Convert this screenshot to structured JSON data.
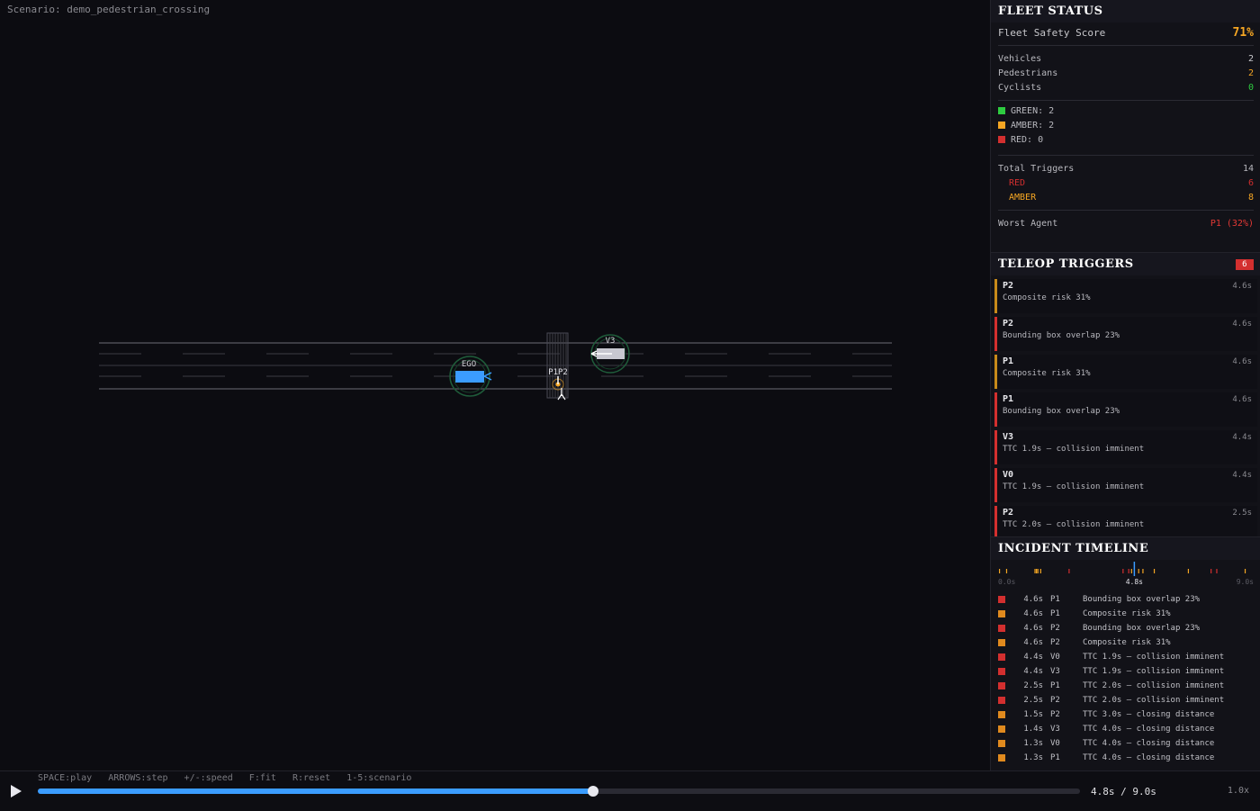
{
  "scene": {
    "scenario_label": "Scenario: demo_pedestrian_crossing",
    "ego_label": "EGO",
    "v3_label": "V3",
    "crossing_labels": "P1P2"
  },
  "fleet": {
    "title": "FLEET STATUS",
    "score_label": "Fleet Safety Score",
    "score_value": "71%",
    "vehicles_label": "Vehicles",
    "vehicles_value": "2",
    "pedestrians_label": "Pedestrians",
    "pedestrians_value": "2",
    "cyclists_label": "Cyclists",
    "cyclists_value": "0",
    "green_label": "GREEN: 2",
    "amber_label": "AMBER: 2",
    "red_label": "RED: 0",
    "total_triggers_label": "Total Triggers",
    "total_triggers_value": "14",
    "red_triggers_label": "RED",
    "red_triggers_value": "6",
    "amber_triggers_label": "AMBER",
    "amber_triggers_value": "8",
    "worst_agent_label": "Worst Agent",
    "worst_agent_value": "P1 (32%)"
  },
  "teleop": {
    "title": "TELEOP TRIGGERS",
    "badge": "6",
    "items": [
      {
        "agent": "P2",
        "time": "4.6s",
        "msg": "Composite risk 31%",
        "level": "amber"
      },
      {
        "agent": "P2",
        "time": "4.6s",
        "msg": "Bounding box overlap 23%",
        "level": "red"
      },
      {
        "agent": "P1",
        "time": "4.6s",
        "msg": "Composite risk 31%",
        "level": "amber"
      },
      {
        "agent": "P1",
        "time": "4.6s",
        "msg": "Bounding box overlap 23%",
        "level": "red"
      },
      {
        "agent": "V3",
        "time": "4.4s",
        "msg": "TTC 1.9s — collision imminent",
        "level": "red"
      },
      {
        "agent": "V0",
        "time": "4.4s",
        "msg": "TTC 1.9s — collision imminent",
        "level": "red"
      },
      {
        "agent": "P2",
        "time": "2.5s",
        "msg": "TTC 2.0s — collision imminent",
        "level": "red"
      }
    ]
  },
  "timeline": {
    "title": "INCIDENT TIMELINE",
    "start_label": "0.0s",
    "current_label": "4.8s",
    "end_label": "9.0s",
    "rows": [
      {
        "level": "red",
        "time": "4.6s",
        "agent": "P1",
        "msg": "Bounding box overlap 23%"
      },
      {
        "level": "amber",
        "time": "4.6s",
        "agent": "P1",
        "msg": "Composite risk 31%"
      },
      {
        "level": "red",
        "time": "4.6s",
        "agent": "P2",
        "msg": "Bounding box overlap 23%"
      },
      {
        "level": "amber",
        "time": "4.6s",
        "agent": "P2",
        "msg": "Composite risk 31%"
      },
      {
        "level": "red",
        "time": "4.4s",
        "agent": "V0",
        "msg": "TTC 1.9s — collision imminent"
      },
      {
        "level": "red",
        "time": "4.4s",
        "agent": "V3",
        "msg": "TTC 1.9s — collision imminent"
      },
      {
        "level": "red",
        "time": "2.5s",
        "agent": "P1",
        "msg": "TTC 2.0s — collision imminent"
      },
      {
        "level": "red",
        "time": "2.5s",
        "agent": "P2",
        "msg": "TTC 2.0s — collision imminent"
      },
      {
        "level": "amber",
        "time": "1.5s",
        "agent": "P2",
        "msg": "TTC 3.0s — closing distance"
      },
      {
        "level": "amber",
        "time": "1.4s",
        "agent": "V3",
        "msg": "TTC 4.0s — closing distance"
      },
      {
        "level": "amber",
        "time": "1.3s",
        "agent": "V0",
        "msg": "TTC 4.0s — closing distance"
      },
      {
        "level": "amber",
        "time": "1.3s",
        "agent": "P1",
        "msg": "TTC 4.0s — closing distance"
      }
    ],
    "markers": [
      {
        "t": 0.05,
        "level": "amber"
      },
      {
        "t": 0.3,
        "level": "amber"
      },
      {
        "t": 1.3,
        "level": "amber"
      },
      {
        "t": 1.35,
        "level": "amber"
      },
      {
        "t": 1.4,
        "level": "amber"
      },
      {
        "t": 1.5,
        "level": "amber"
      },
      {
        "t": 2.5,
        "level": "red"
      },
      {
        "t": 4.4,
        "level": "red"
      },
      {
        "t": 4.6,
        "level": "red"
      },
      {
        "t": 4.7,
        "level": "amber"
      },
      {
        "t": 4.95,
        "level": "amber"
      },
      {
        "t": 5.1,
        "level": "amber"
      },
      {
        "t": 5.5,
        "level": "amber"
      },
      {
        "t": 6.7,
        "level": "amber"
      },
      {
        "t": 7.5,
        "level": "red"
      },
      {
        "t": 7.7,
        "level": "red"
      },
      {
        "t": 8.7,
        "level": "amber"
      }
    ]
  },
  "playback": {
    "hints": "SPACE:play   ARROWS:step   +/-:speed   F:fit   R:reset   1-5:scenario",
    "time_label": "4.8s / 9.0s",
    "speed_label": "1.0x",
    "progress": 0.533
  },
  "colors": {
    "red": "#d32f2f",
    "amber": "#f5a623",
    "green": "#2ecc40",
    "accent": "#3b9cff"
  }
}
